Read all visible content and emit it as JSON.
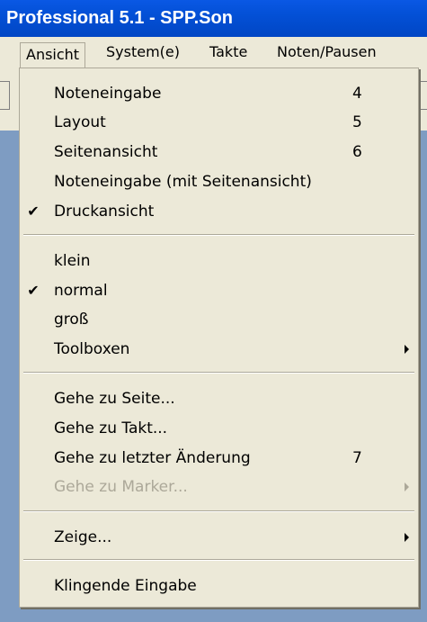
{
  "window": {
    "title": "Professional 5.1  - SPP.Son"
  },
  "menubar": {
    "items": [
      {
        "label": "Ansicht"
      },
      {
        "label": "System(e)"
      },
      {
        "label": "Takte"
      },
      {
        "label": "Noten/Pausen"
      }
    ]
  },
  "menu": {
    "check_glyph": "✔",
    "items": [
      {
        "label": "Noteneingabe",
        "shortcut": "4",
        "checked": false,
        "enabled": true
      },
      {
        "label": "Layout",
        "shortcut": "5",
        "checked": false,
        "enabled": true
      },
      {
        "label": "Seitenansicht",
        "shortcut": "6",
        "checked": false,
        "enabled": true
      },
      {
        "label": "Noteneingabe (mit Seitenansicht)",
        "shortcut": "",
        "checked": false,
        "enabled": true
      },
      {
        "label": "Druckansicht",
        "shortcut": "",
        "checked": true,
        "enabled": true
      },
      {
        "label": "klein",
        "shortcut": "",
        "checked": false,
        "enabled": true
      },
      {
        "label": "normal",
        "shortcut": "",
        "checked": true,
        "enabled": true
      },
      {
        "label": "groß",
        "shortcut": "",
        "checked": false,
        "enabled": true
      },
      {
        "label": "Toolboxen",
        "shortcut": "",
        "checked": false,
        "enabled": true,
        "submenu": true
      },
      {
        "label": "Gehe zu Seite...",
        "shortcut": "",
        "checked": false,
        "enabled": true
      },
      {
        "label": "Gehe zu Takt...",
        "shortcut": "",
        "checked": false,
        "enabled": true
      },
      {
        "label": "Gehe zu letzter Änderung",
        "shortcut": "7",
        "checked": false,
        "enabled": true
      },
      {
        "label": "Gehe zu Marker...",
        "shortcut": "",
        "checked": false,
        "enabled": false,
        "submenu": true
      },
      {
        "label": "Zeige...",
        "shortcut": "",
        "checked": false,
        "enabled": true,
        "submenu": true
      },
      {
        "label": "Klingende Eingabe",
        "shortcut": "",
        "checked": false,
        "enabled": true
      }
    ]
  },
  "colors": {
    "titlebar": "#0350d6",
    "menu_bg": "#ece9d8",
    "disabled_text": "#aca899",
    "desktop": "#7e9cc2"
  }
}
